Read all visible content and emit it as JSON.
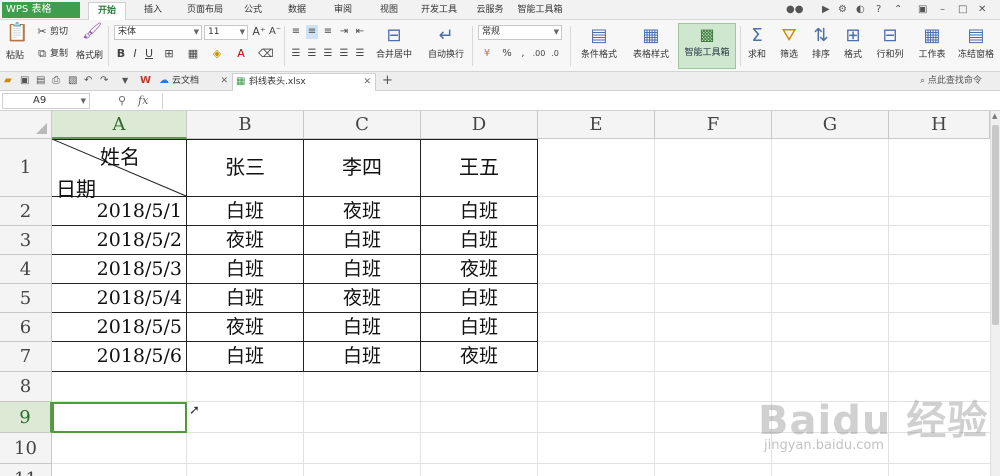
{
  "app": {
    "logo": "WPS 表格"
  },
  "menu": {
    "tabs": [
      "开始",
      "插入",
      "页面布局",
      "公式",
      "数据",
      "审阅",
      "视图",
      "开发工具",
      "云服务",
      "智能工具箱"
    ],
    "active": "开始"
  },
  "ribbon": {
    "paste": "粘贴",
    "cut": "剪切",
    "copy": "复制",
    "format_painter": "格式刷",
    "font_name": "宋体",
    "font_size": "11",
    "bold": "B",
    "italic": "I",
    "underline": "U",
    "merge_center": "合并居中",
    "wrap_text": "自动换行",
    "number_format": "常规",
    "percent": "%",
    "conditional_format": "条件格式",
    "table_style": "表格样式",
    "smart_toolbox": "智能工具箱",
    "sum": "求和",
    "filter": "筛选",
    "sort": "排序",
    "format": "格式",
    "row_col": "行和列",
    "worksheet": "工作表",
    "freeze": "冻结窗格"
  },
  "tabs_bar": {
    "cloud_doc": "云文档",
    "file_tab": "斜线表头.xlsx",
    "add": "+",
    "search_cmd": "点此查找命令"
  },
  "formula_bar": {
    "name_box": "A9",
    "fx": "fx",
    "content": ""
  },
  "columns": [
    "A",
    "B",
    "C",
    "D",
    "E",
    "F",
    "G",
    "H"
  ],
  "rows": [
    "1",
    "2",
    "3",
    "4",
    "5",
    "6",
    "7",
    "8",
    "9",
    "10",
    "11"
  ],
  "selected_cell": "A9",
  "table": {
    "diag_top": "姓名",
    "diag_bottom": "日期",
    "headers": [
      "张三",
      "李四",
      "王五"
    ],
    "rows": [
      {
        "date": "2018/5/1",
        "shifts": [
          "白班",
          "夜班",
          "白班"
        ]
      },
      {
        "date": "2018/5/2",
        "shifts": [
          "夜班",
          "白班",
          "白班"
        ]
      },
      {
        "date": "2018/5/3",
        "shifts": [
          "白班",
          "白班",
          "夜班"
        ]
      },
      {
        "date": "2018/5/4",
        "shifts": [
          "白班",
          "夜班",
          "白班"
        ]
      },
      {
        "date": "2018/5/5",
        "shifts": [
          "夜班",
          "白班",
          "白班"
        ]
      },
      {
        "date": "2018/5/6",
        "shifts": [
          "白班",
          "白班",
          "夜班"
        ]
      }
    ]
  },
  "watermark": {
    "main": "Baidu 经验",
    "sub": "jingyan.baidu.com"
  }
}
